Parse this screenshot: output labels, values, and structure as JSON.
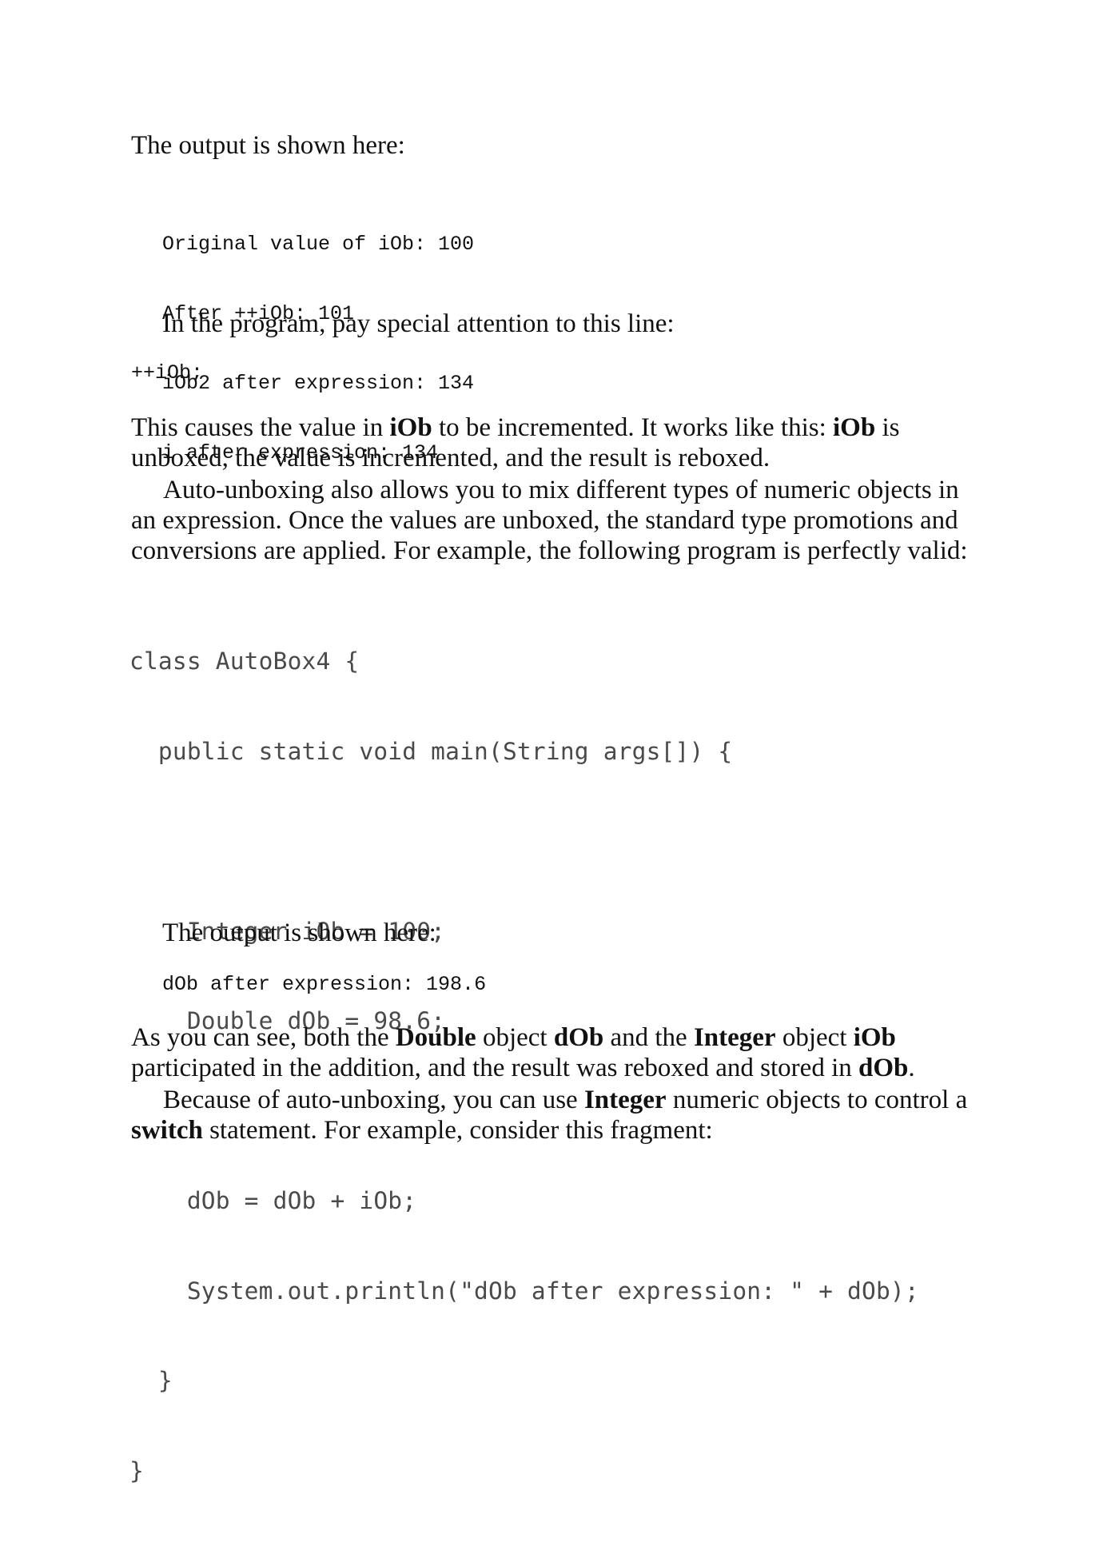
{
  "intro_heading": "The output is shown here:",
  "output1": [
    "Original value of iOb: 100",
    "After ++iOb: 101",
    "iOb2 after expression: 134",
    "i after expression: 134"
  ],
  "para_attention": "In the program, pay special attention to this line:",
  "code_increment": "++iOb;",
  "para_causes": {
    "t1": "This causes the value in ",
    "b1": "iOb",
    "t2": " to be incremented. It works like this: ",
    "b2": "iOb",
    "t3": " is",
    "line2": "unboxed, the value is incremented, and the result is reboxed."
  },
  "para_autounboxing": {
    "line1": "Auto-unboxing also allows you to mix different types of numeric objects in",
    "line2": "an expression. Once the values are unboxed, the standard type promotions and",
    "line3": "conversions are applied. For example, the following program is perfectly valid:"
  },
  "program_listing": [
    "class AutoBox4 {",
    "  public static void main(String args[]) {",
    "",
    "    Integer iOb = 100;",
    "    Double dOb = 98.6;",
    "",
    "    dOb = dOb + iOb;",
    "    System.out.println(\"dOb after expression: \" + dOb);",
    "  }",
    "}"
  ],
  "output2_heading": "The output is shown here:",
  "output2": "dOb after expression: 198.6",
  "para_asyoucansee": {
    "t1": "As you can see, both the ",
    "b1": "Double",
    "t2": " object ",
    "b2": "dOb",
    "t3": " and the ",
    "b3": "Integer",
    "t4": " object ",
    "b4": "iOb",
    "line2_t1": "participated in the addition, and the result was reboxed and stored in ",
    "line2_b1": "dOb",
    "line2_t2": "."
  },
  "para_because": {
    "t1": "Because of auto-unboxing, you can use ",
    "b1": "Integer",
    "t2": " numeric objects to control a",
    "line2_b1": "switch",
    "line2_t1": " statement. For example, consider this fragment:"
  }
}
